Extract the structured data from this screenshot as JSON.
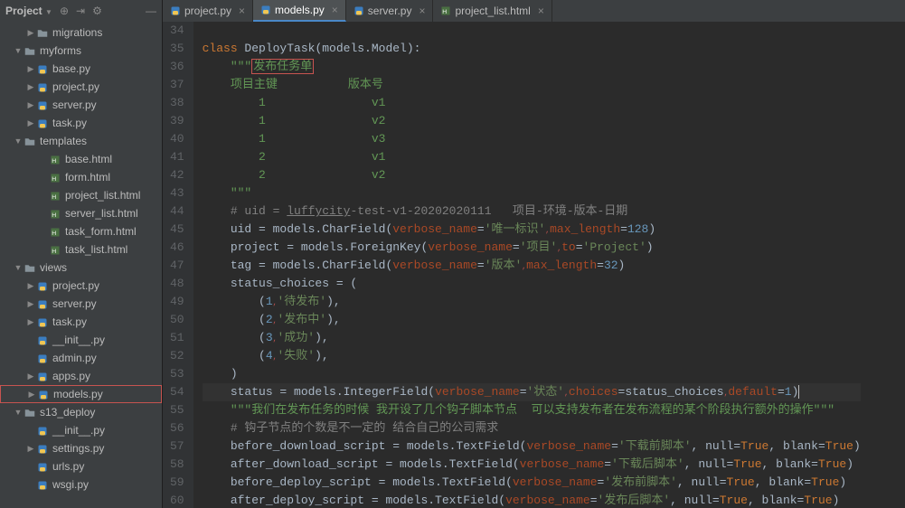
{
  "projectPanel": {
    "title": "Project"
  },
  "tabs": [
    {
      "label": "project.py",
      "type": "py",
      "active": false
    },
    {
      "label": "models.py",
      "type": "py",
      "active": true
    },
    {
      "label": "server.py",
      "type": "py",
      "active": false
    },
    {
      "label": "project_list.html",
      "type": "html",
      "active": false
    }
  ],
  "tree": [
    {
      "indent": 2,
      "arrow": "right",
      "icon": "folder",
      "label": "migrations"
    },
    {
      "indent": 1,
      "arrow": "down",
      "icon": "folder",
      "label": "myforms"
    },
    {
      "indent": 2,
      "arrow": "right",
      "icon": "py",
      "label": "base.py"
    },
    {
      "indent": 2,
      "arrow": "right",
      "icon": "py",
      "label": "project.py"
    },
    {
      "indent": 2,
      "arrow": "right",
      "icon": "py",
      "label": "server.py"
    },
    {
      "indent": 2,
      "arrow": "right",
      "icon": "py",
      "label": "task.py"
    },
    {
      "indent": 1,
      "arrow": "down",
      "icon": "folder",
      "label": "templates"
    },
    {
      "indent": 3,
      "arrow": "",
      "icon": "html",
      "label": "base.html"
    },
    {
      "indent": 3,
      "arrow": "",
      "icon": "html",
      "label": "form.html"
    },
    {
      "indent": 3,
      "arrow": "",
      "icon": "html",
      "label": "project_list.html"
    },
    {
      "indent": 3,
      "arrow": "",
      "icon": "html",
      "label": "server_list.html"
    },
    {
      "indent": 3,
      "arrow": "",
      "icon": "html",
      "label": "task_form.html"
    },
    {
      "indent": 3,
      "arrow": "",
      "icon": "html",
      "label": "task_list.html"
    },
    {
      "indent": 1,
      "arrow": "down",
      "icon": "folder",
      "label": "views"
    },
    {
      "indent": 2,
      "arrow": "right",
      "icon": "py",
      "label": "project.py"
    },
    {
      "indent": 2,
      "arrow": "right",
      "icon": "py",
      "label": "server.py"
    },
    {
      "indent": 2,
      "arrow": "right",
      "icon": "py",
      "label": "task.py"
    },
    {
      "indent": 2,
      "arrow": "",
      "icon": "py",
      "label": "__init__.py"
    },
    {
      "indent": 2,
      "arrow": "",
      "icon": "py",
      "label": "admin.py"
    },
    {
      "indent": 2,
      "arrow": "right",
      "icon": "py",
      "label": "apps.py"
    },
    {
      "indent": 2,
      "arrow": "right",
      "icon": "py",
      "label": "models.py",
      "selected": true
    },
    {
      "indent": 1,
      "arrow": "down",
      "icon": "folder",
      "label": "s13_deploy"
    },
    {
      "indent": 2,
      "arrow": "",
      "icon": "py",
      "label": "__init__.py"
    },
    {
      "indent": 2,
      "arrow": "right",
      "icon": "py",
      "label": "settings.py"
    },
    {
      "indent": 2,
      "arrow": "",
      "icon": "py",
      "label": "urls.py"
    },
    {
      "indent": 2,
      "arrow": "",
      "icon": "py",
      "label": "wsgi.py"
    }
  ],
  "code": {
    "firstLine": 34,
    "lines": [
      {
        "n": 34,
        "html": ""
      },
      {
        "n": 35,
        "html": "<span class='kw'>class </span><span class='cls'>DeployTask</span>(models.Model):"
      },
      {
        "n": 36,
        "html": "    <span class='doc'>\"\"\"<span class='highlight'>发布任务单</span></span>"
      },
      {
        "n": 37,
        "html": "    <span class='doc'>项目主键          版本号</span>"
      },
      {
        "n": 38,
        "html": "    <span class='doc'>    1               v1</span>"
      },
      {
        "n": 39,
        "html": "    <span class='doc'>    1               v2</span>"
      },
      {
        "n": 40,
        "html": "    <span class='doc'>    1               v3</span>"
      },
      {
        "n": 41,
        "html": "    <span class='doc'>    2               v1</span>"
      },
      {
        "n": 42,
        "html": "    <span class='doc'>    2               v2</span>"
      },
      {
        "n": 43,
        "html": "    <span class='doc'>\"\"\"</span>"
      },
      {
        "n": 44,
        "html": "    <span class='comment'># uid = <u>luffycity</u>-test-v1-20202020111   项目-环境-版本-日期</span>"
      },
      {
        "n": 45,
        "html": "    uid = models.CharField(<span class='param'>verbose_name</span>=<span class='str'>'唯一标识'</span><span class='red-dot'>,</span><span class='param'>max_length</span>=<span class='num'>128</span>)"
      },
      {
        "n": 46,
        "html": "    project = models.ForeignKey(<span class='param'>verbose_name</span>=<span class='str'>'项目'</span><span class='red-dot'>,</span><span class='param'>to</span>=<span class='str'>'Project'</span>)"
      },
      {
        "n": 47,
        "html": "    tag = models.CharField(<span class='param'>verbose_name</span>=<span class='str'>'版本'</span><span class='red-dot'>,</span><span class='param'>max_length</span>=<span class='num'>32</span>)"
      },
      {
        "n": 48,
        "html": "    status_choices = ("
      },
      {
        "n": 49,
        "html": "        (<span class='num'>1</span><span class='red-dot'>,</span><span class='str'>'待发布'</span>),"
      },
      {
        "n": 50,
        "html": "        (<span class='num'>2</span><span class='red-dot'>,</span><span class='str'>'发布中'</span>),"
      },
      {
        "n": 51,
        "html": "        (<span class='num'>3</span><span class='red-dot'>,</span><span class='str'>'成功'</span>),"
      },
      {
        "n": 52,
        "html": "        (<span class='num'>4</span><span class='red-dot'>,</span><span class='str'>'失败'</span>),"
      },
      {
        "n": 53,
        "html": "    )"
      },
      {
        "n": 54,
        "html": "    status = models.IntegerField(<span class='param'>verbose_name</span>=<span class='str'>'状态'</span><span class='red-dot'>,</span><span class='param'>choices</span>=status_choices<span class='red-dot'>,</span><span class='param'>default</span>=<span class='num'>1</span>)<span style='border-left:1px solid #bbb;'></span>",
        "caret": true
      },
      {
        "n": 55,
        "html": "    <span class='doc'>\"\"\"我们在发布任务的时候 我开设了几个钩子脚本节点  可以支持发布者在发布流程的某个阶段执行额外的操作\"\"\"</span>"
      },
      {
        "n": 56,
        "html": "    <span class='comment'># 钩子节点的个数是不一定的 结合自己的公司需求</span>"
      },
      {
        "n": 57,
        "html": "    before_download_script = models.TextField(<span class='param'>verbose_name</span>=<span class='str'>'下载前脚本'</span>, null=<span class='kw'>True</span>, blank=<span class='kw'>True</span>)"
      },
      {
        "n": 58,
        "html": "    after_download_script = models.TextField(<span class='param'>verbose_name</span>=<span class='str'>'下载后脚本'</span>, null=<span class='kw'>True</span>, blank=<span class='kw'>True</span>)"
      },
      {
        "n": 59,
        "html": "    before_deploy_script = models.TextField(<span class='param'>verbose_name</span>=<span class='str'>'发布前脚本'</span>, null=<span class='kw'>True</span>, blank=<span class='kw'>True</span>)"
      },
      {
        "n": 60,
        "html": "    after_deploy_script = models.TextField(<span class='param'>verbose_name</span>=<span class='str'>'发布后脚本'</span>, null=<span class='kw'>True</span>, blank=<span class='kw'>True</span>)"
      }
    ]
  }
}
